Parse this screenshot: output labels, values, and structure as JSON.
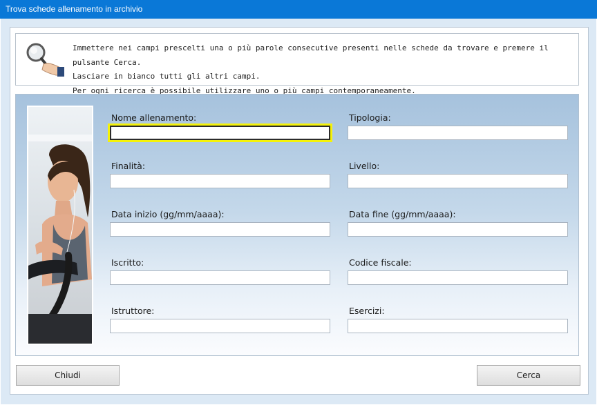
{
  "window": {
    "title": "Trova schede allenamento in archivio"
  },
  "info": {
    "lines": [
      "Immettere nei campi prescelti una o più parole consecutive presenti nelle schede da trovare e premere il pulsante Cerca.",
      "Lasciare in bianco tutti gli altri campi.",
      "Per ogni ricerca è possibile utilizzare uno o più campi contemporaneamente."
    ]
  },
  "form": {
    "fields": [
      {
        "label": "Nome allenamento:",
        "value": "",
        "focused": true
      },
      {
        "label": "Tipologia:",
        "value": ""
      },
      {
        "label": "Finalità:",
        "value": ""
      },
      {
        "label": "Livello:",
        "value": ""
      },
      {
        "label": "Data inizio (gg/mm/aaaa):",
        "value": ""
      },
      {
        "label": "Data fine (gg/mm/aaaa):",
        "value": ""
      },
      {
        "label": "Iscritto:",
        "value": ""
      },
      {
        "label": "Codice fiscale:",
        "value": ""
      },
      {
        "label": "Istruttore:",
        "value": ""
      },
      {
        "label": "Esercizi:",
        "value": ""
      }
    ]
  },
  "buttons": {
    "close_label": "Chiudi",
    "search_label": "Cerca"
  },
  "colors": {
    "titlebar": "#0a78d7",
    "focus_highlight": "#f5f20a",
    "panel_top": "#a6c2dd"
  }
}
